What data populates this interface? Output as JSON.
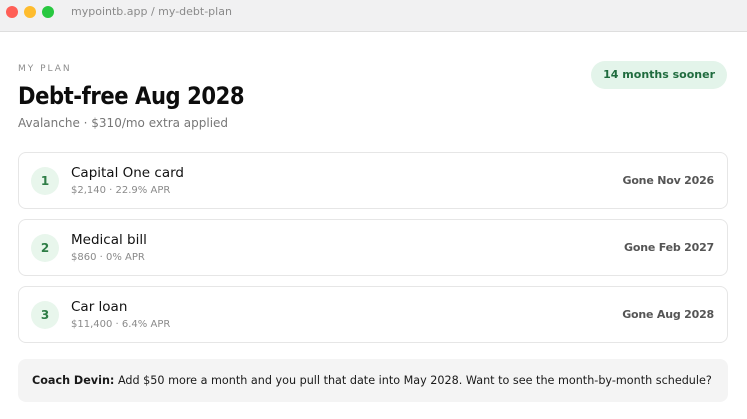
{
  "window": {
    "url": "mypointb.app / my-debt-plan"
  },
  "plan": {
    "eyebrow": "MY PLAN",
    "headline": "Debt-free Aug 2028",
    "subline": "Avalanche · $310/mo extra applied",
    "badge": "14 months sooner"
  },
  "debts": [
    {
      "rank": "1",
      "name": "Capital One card",
      "meta": "$2,140 · 22.9% APR",
      "gone": "Gone Nov 2026"
    },
    {
      "rank": "2",
      "name": "Medical bill",
      "meta": "$860 · 0% APR",
      "gone": "Gone Feb 2027"
    },
    {
      "rank": "3",
      "name": "Car loan",
      "meta": "$11,400 · 6.4% APR",
      "gone": "Gone Aug 2028"
    }
  ],
  "coach": {
    "name": "Coach Devin:",
    "message": "Add $50 more a month and you pull that date into May 2028. Want to see the month-by-month schedule?"
  },
  "colors": {
    "badge_bg": "#e3f4ea",
    "badge_text": "#1f6b3e",
    "rank_bg": "#e8f6ec",
    "rank_text": "#2e7d46",
    "window_close": "#ff5f57",
    "window_minimize": "#febc2e",
    "window_zoom": "#28c840"
  }
}
